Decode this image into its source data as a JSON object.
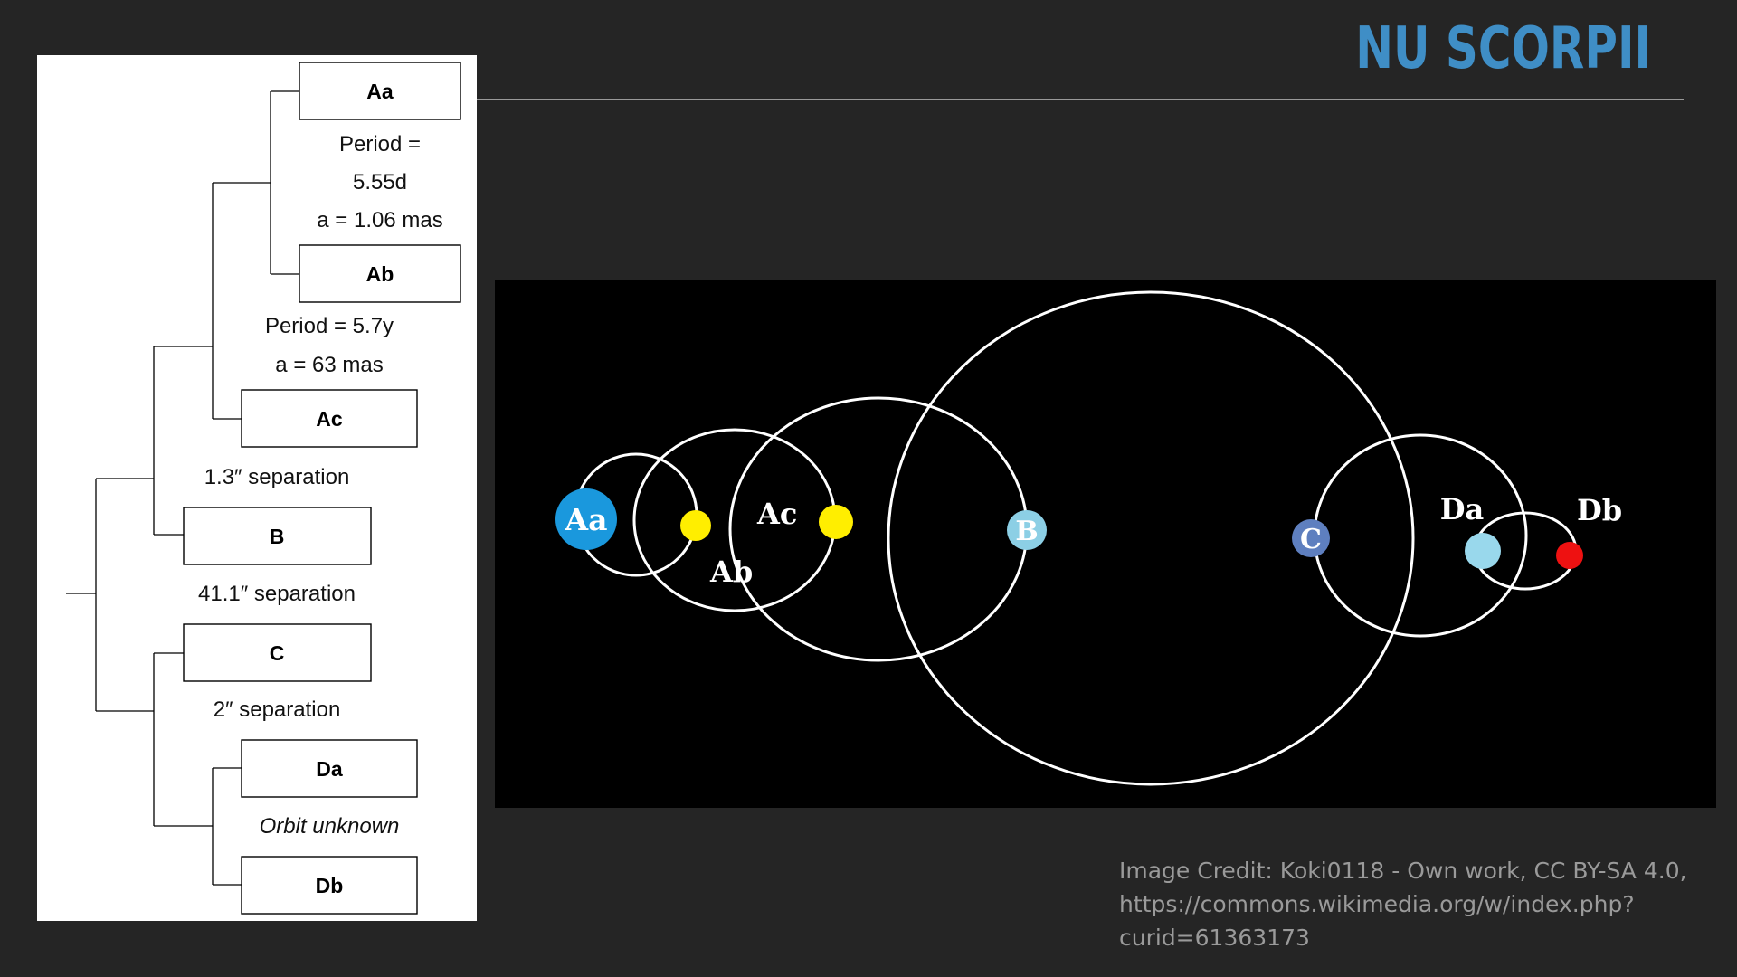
{
  "slide": {
    "title": "NU SCORPII",
    "accent_color": "#3f8ec6",
    "background_color": "#252525"
  },
  "hierarchy": {
    "stars": {
      "aa": "Aa",
      "ab": "Ab",
      "ac": "Ac",
      "b": "B",
      "c": "C",
      "da": "Da",
      "db": "Db"
    },
    "aa_ab_orbit": {
      "period_line1": "Period =",
      "period_line2": "5.55d",
      "semi_major_axis": "a = 1.06 mas"
    },
    "a_ac_orbit": {
      "period": "Period = 5.7y",
      "semi_major_axis": "a = 63 mas"
    },
    "a_b_separation": "1.3″ separation",
    "ab_c_separation": "41.1″ separation",
    "c_d_separation": "2″ separation",
    "d_orbit": "Orbit unknown"
  },
  "orbit_diagram": {
    "labels": {
      "aa": "Aa",
      "ab": "Ab",
      "ac": "Ac",
      "b": "B",
      "c": "C",
      "da": "Da",
      "db": "Db"
    },
    "colors": {
      "aa": "#1a98dd",
      "ab": "#ffee00",
      "ac": "#ffee00",
      "b": "#8ccfe5",
      "c": "#5e7fbf",
      "da": "#99d8ec",
      "db": "#ee1111"
    }
  },
  "credit": {
    "line1": "Image Credit: Koki0118 - Own work, CC BY-SA 4.0,",
    "line2": "https://commons.wikimedia.org/w/index.php?",
    "line3": "curid=61363173"
  }
}
